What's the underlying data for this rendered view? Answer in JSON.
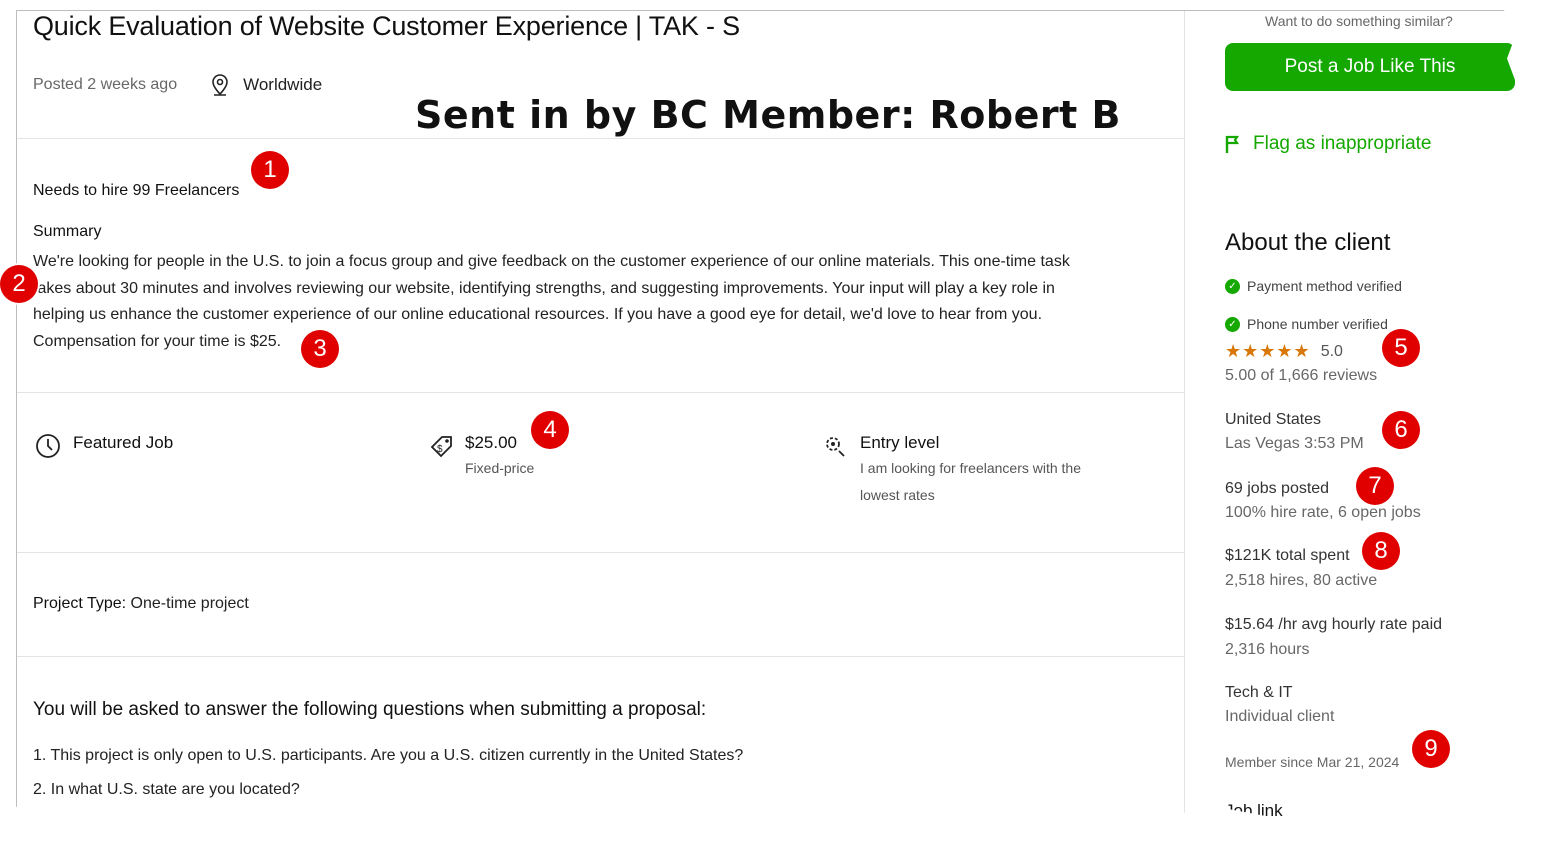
{
  "job": {
    "title": "Quick Evaluation of Website Customer Experience | TAK - S",
    "posted": "Posted 2 weeks ago",
    "location": "Worldwide",
    "hire_count": "Needs to hire 99 Freelancers",
    "summary_heading": "Summary",
    "summary_lines": [
      "We're looking for people in the U.S. to join a focus group and give feedback on the customer experience of our online materials. This one-time task",
      "takes about 30 minutes and involves reviewing our website, identifying strengths, and suggesting improvements. Your input will play a key role in",
      "helping us enhance the customer experience of our online educational resources. If you have a good eye for detail, we'd love to hear from you.",
      "Compensation for your time is $25."
    ],
    "features": {
      "featured_label": "Featured Job",
      "price": "$25.00",
      "price_type": "Fixed-price",
      "level": "Entry level",
      "level_desc_1": "I am looking for freelancers with the",
      "level_desc_2": "lowest rates"
    },
    "project_type_label": "Project Type:",
    "project_type_value": "One-time project",
    "questions_heading": "You will be asked to answer the following questions when submitting a proposal:",
    "questions": [
      "1. This project is only open to U.S. participants. Are you a U.S. citizen currently in the United States?",
      "2. In what U.S. state are you located?"
    ]
  },
  "watermark": "Sent in by BC Member: Robert B",
  "sidebar": {
    "similar_prompt": "Want to do something similar?",
    "post_button": "Post a Job Like This",
    "flag_link": "Flag as inappropriate",
    "about_heading": "About the client",
    "payment_verified": "Payment method verified",
    "phone_verified": "Phone number verified",
    "rating_value": "5.0",
    "rating_stars": 5,
    "reviews": "5.00 of 1,666 reviews",
    "country": "United States",
    "city_time": "Las Vegas 3:53 PM",
    "jobs_posted": "69 jobs posted",
    "hire_rate": "100% hire rate, 6 open jobs",
    "total_spent": "$121K total spent",
    "hires": "2,518 hires, 80 active",
    "avg_rate": "$15.64 /hr avg hourly rate paid",
    "hours": "2,316 hours",
    "industry": "Tech & IT",
    "client_type": "Individual client",
    "member_since": "Member since Mar 21, 2024",
    "job_link_partial": "Job link"
  },
  "annotations": [
    "1",
    "2",
    "3",
    "4",
    "5",
    "6",
    "7",
    "8",
    "9"
  ],
  "colors": {
    "brand_green": "#14a800",
    "star_orange": "#d97706",
    "annotation_red": "#e00000"
  }
}
